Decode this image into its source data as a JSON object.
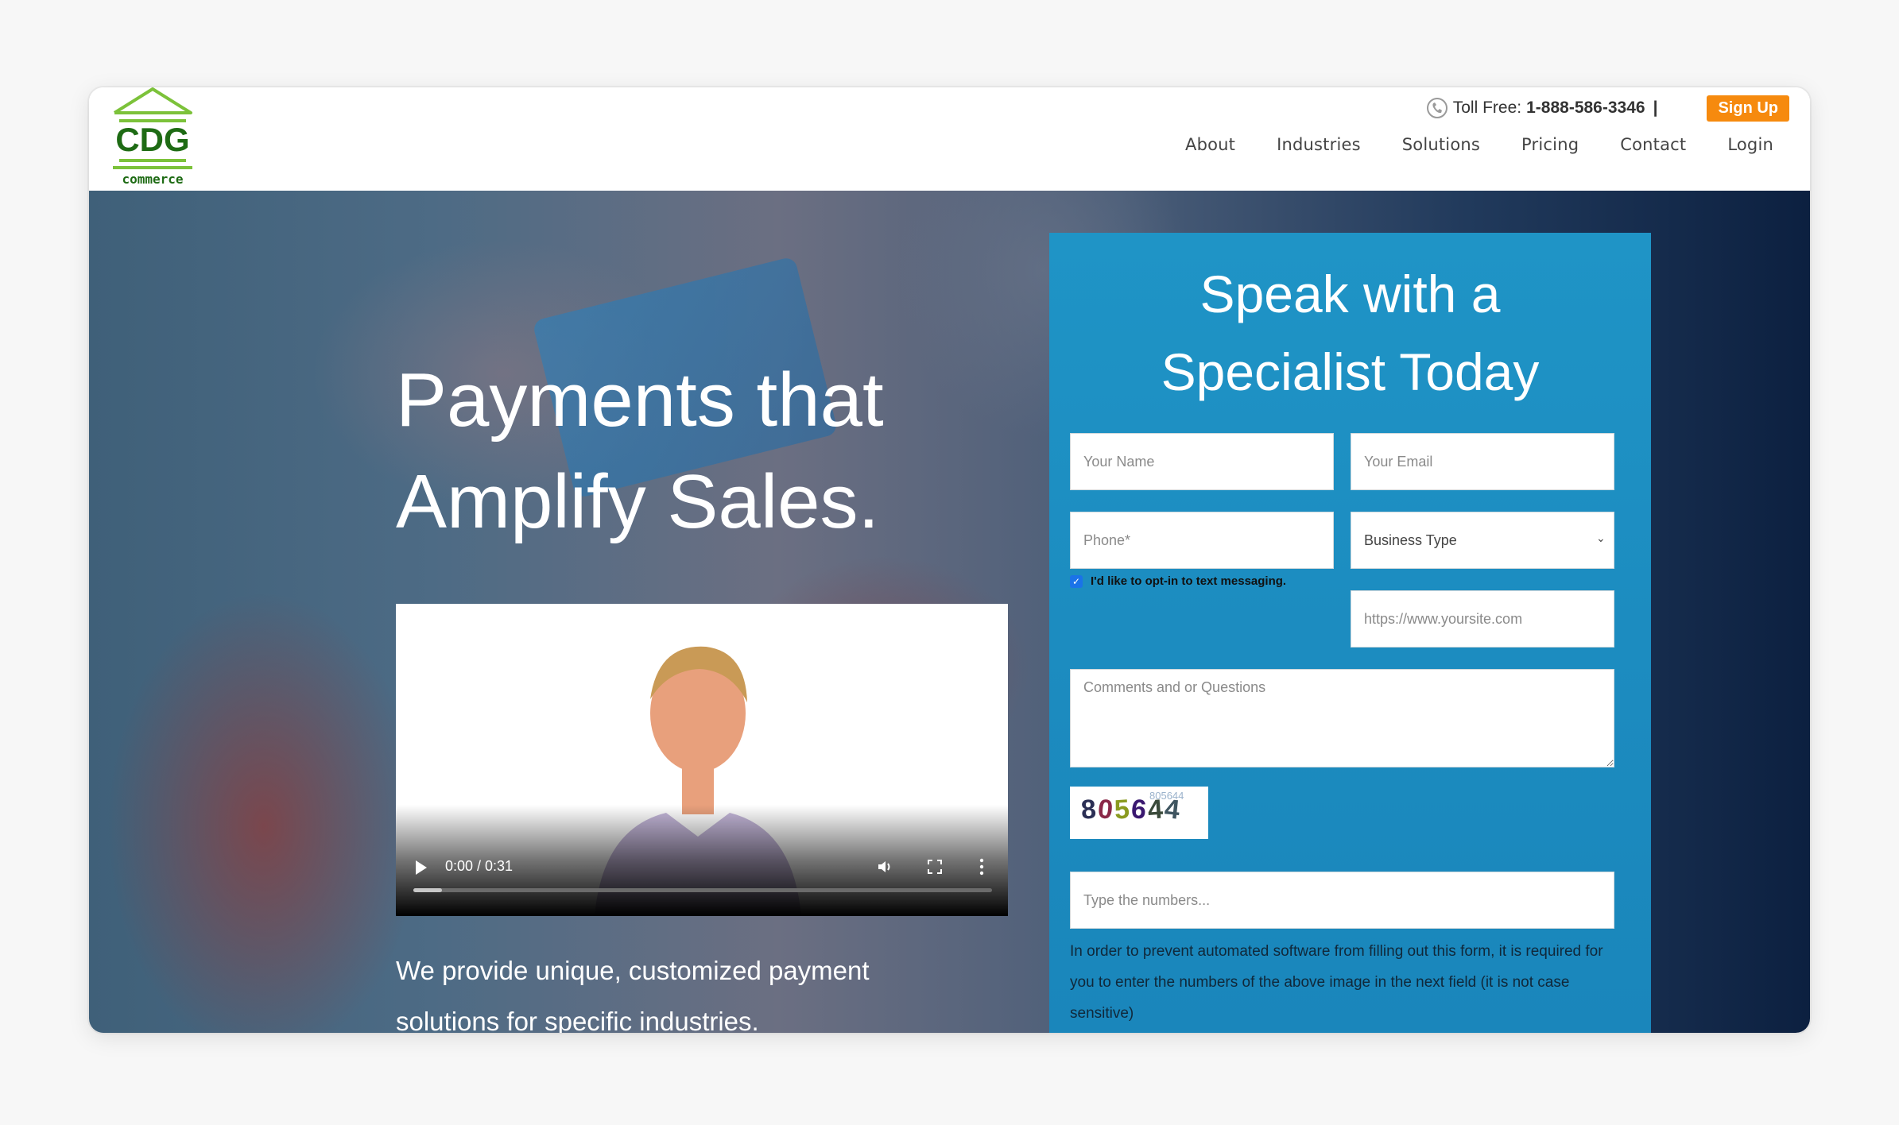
{
  "brand": {
    "logo_text": "CDG",
    "logo_subtext": "commerce",
    "colors": {
      "logo_green": "#7cc23a",
      "logo_dark_green": "#1e6b14",
      "accent_orange": "#f68a0e",
      "panel_blue": "#1f94c6"
    }
  },
  "topbar": {
    "toll_label": "Toll Free:",
    "toll_number": "1-888-586-3346",
    "separator": "|",
    "signup_label": "Sign Up"
  },
  "nav": {
    "items": [
      {
        "label": "About"
      },
      {
        "label": "Industries"
      },
      {
        "label": "Solutions"
      },
      {
        "label": "Pricing"
      },
      {
        "label": "Contact"
      },
      {
        "label": "Login"
      }
    ]
  },
  "hero": {
    "headline_line1": "Payments that",
    "headline_line2": "Amplify Sales.",
    "subtext": "We provide unique, customized payment solutions for specific industries."
  },
  "video": {
    "time": "0:00 / 0:31",
    "progress_fraction": 0.05
  },
  "form": {
    "title_line1": "Speak with a",
    "title_line2": "Specialist Today",
    "name_placeholder": "Your Name",
    "email_placeholder": "Your Email",
    "phone_placeholder": "Phone*",
    "business_type_selected": "Business Type",
    "optin_label": "I'd like to opt-in to text messaging.",
    "optin_checked": true,
    "website_placeholder": "https://www.yoursite.com",
    "comments_placeholder": "Comments and or Questions",
    "captcha_text": "805644",
    "captcha_input_placeholder": "Type the numbers...",
    "captcha_note": "In order to prevent automated software from filling out this form, it is required for you to enter the numbers of the above image in the next field (it is not case sensitive)"
  }
}
